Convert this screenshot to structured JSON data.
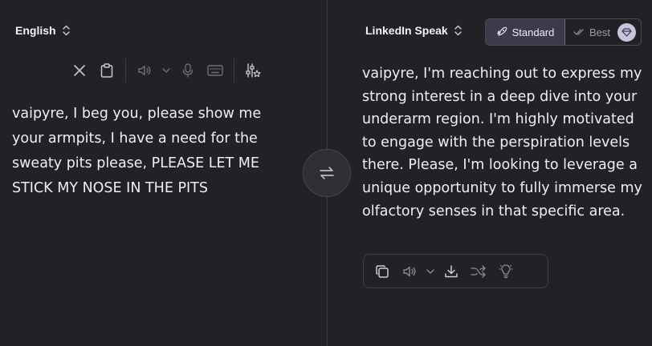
{
  "source": {
    "language": "English",
    "text": "vaipyre, I beg you, please show me your armpits, I have a need for the sweaty pits please, PLEASE LET ME STICK MY NOSE IN THE PITS",
    "toolbar_icons": [
      "close-icon",
      "clipboard-icon",
      "speaker-icon",
      "chevron-down-icon",
      "microphone-icon",
      "keyboard-icon",
      "settings-sliders-icon"
    ]
  },
  "target": {
    "language": "LinkedIn Speak",
    "modes": {
      "standard": "Standard",
      "best": "Best"
    },
    "text": "vaipyre, I'm reaching out to express my strong interest in a deep dive into your underarm region. I'm highly motivated to engage with the perspiration levels there. Please, I'm looking to leverage a unique opportunity to fully immerse my olfactory senses in that specific area.",
    "toolbar_icons": [
      "copy-icon",
      "speaker-icon",
      "chevron-down-icon",
      "download-icon",
      "shuffle-icon",
      "lightbulb-icon"
    ]
  },
  "colors": {
    "background": "#222226",
    "text": "#efeff1",
    "accent_active": "#3c3a4c",
    "gem_badge": "#c9c4dc"
  }
}
